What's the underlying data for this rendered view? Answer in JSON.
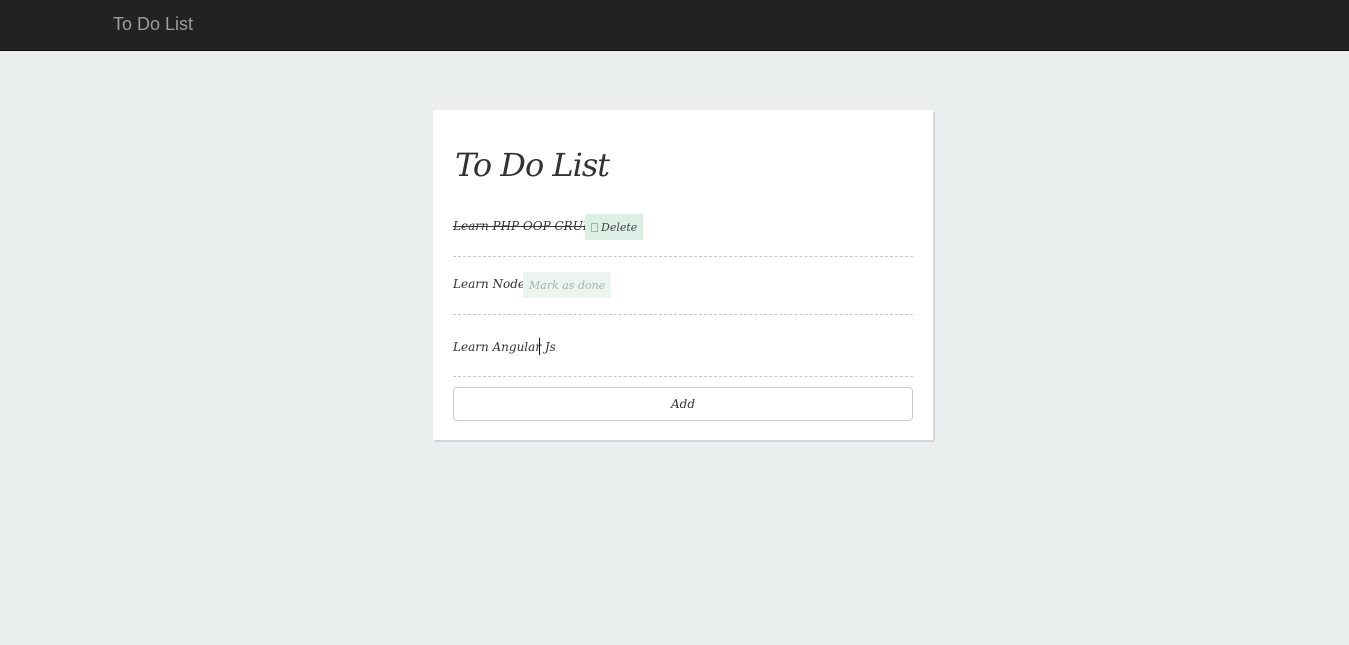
{
  "navbar": {
    "brand": "To Do List"
  },
  "todo": {
    "title": "To Do List",
    "items": [
      {
        "text": "Learn PHP OOP CRUD",
        "done": true,
        "action_label": "Delete",
        "action_icon": "trash-icon"
      },
      {
        "text": "Learn Node.js",
        "done": false,
        "action_label": "Mark as done"
      }
    ],
    "new_item_value": "Learn Angular Js",
    "add_label": "Add"
  },
  "colors": {
    "navbar_bg": "#222222",
    "page_bg": "#eaeeee",
    "delete_bg": "#dcefe4",
    "mark_bg": "#ebf4ee"
  }
}
